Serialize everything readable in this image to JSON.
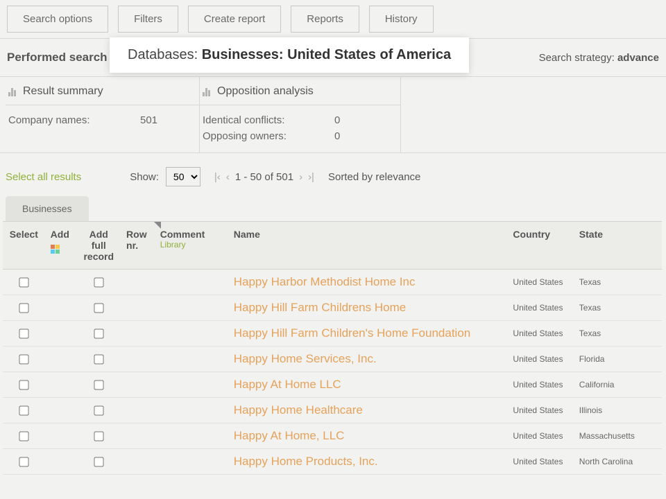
{
  "toolbar": {
    "search_options": "Search options",
    "filters": "Filters",
    "create_report": "Create report",
    "reports": "Reports",
    "history": "History"
  },
  "performed": {
    "title": "Performed search",
    "db_label": "Databases: ",
    "db_value": "Businesses: United States of America",
    "strategy_label": "Search strategy: ",
    "strategy_value": "advance"
  },
  "summary": {
    "result_title": "Result summary",
    "company_names_label": "Company names:",
    "company_names_value": "501",
    "opposition_title": "Opposition analysis",
    "identical_label": "Identical conflicts:",
    "identical_value": "0",
    "opposing_label": "Opposing owners:",
    "opposing_value": "0"
  },
  "controls": {
    "select_all": "Select all results",
    "show_label": "Show:",
    "page_size": "50",
    "range_text": "1 - 50  of  501",
    "sorted_by": "Sorted by relevance"
  },
  "tabs": {
    "businesses": "Businesses"
  },
  "columns": {
    "select": "Select",
    "add": "Add",
    "add_full": "Add full record",
    "row_nr": "Row nr.",
    "comment": "Comment",
    "comment_sub": "Library",
    "name": "Name",
    "country": "Country",
    "state": "State"
  },
  "rows": [
    {
      "name": "Happy Harbor Methodist Home Inc",
      "country": "United States",
      "state": "Texas"
    },
    {
      "name": "Happy Hill Farm Childrens Home",
      "country": "United States",
      "state": "Texas"
    },
    {
      "name": "Happy Hill Farm Children's Home Foundation",
      "country": "United States",
      "state": "Texas"
    },
    {
      "name": "Happy Home Services, Inc.",
      "country": "United States",
      "state": "Florida"
    },
    {
      "name": "Happy At Home LLC",
      "country": "United States",
      "state": "California"
    },
    {
      "name": "Happy Home Healthcare",
      "country": "United States",
      "state": "Illinois"
    },
    {
      "name": "Happy At Home, LLC",
      "country": "United States",
      "state": "Massachusetts"
    },
    {
      "name": "Happy Home Products, Inc.",
      "country": "United States",
      "state": "North Carolina"
    }
  ]
}
